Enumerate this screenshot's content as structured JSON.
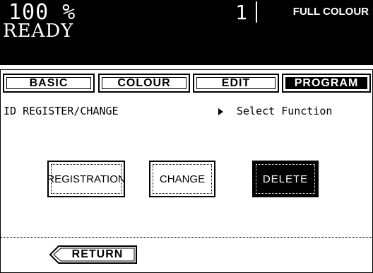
{
  "status": {
    "zoom": "100 %",
    "copies": "1",
    "colour_mode": "FULL COLOUR",
    "state": "READY"
  },
  "tabs": [
    {
      "label": "BASIC",
      "active": false
    },
    {
      "label": "COLOUR",
      "active": false
    },
    {
      "label": "EDIT",
      "active": false
    },
    {
      "label": "PROGRAM",
      "active": true
    }
  ],
  "breadcrumb": "ID REGISTER/CHANGE",
  "instruction": "Select Function",
  "buttons": {
    "registration": "REGISTRATION",
    "change": "CHANGE",
    "delete": "DELETE"
  },
  "return_label": "RETURN"
}
